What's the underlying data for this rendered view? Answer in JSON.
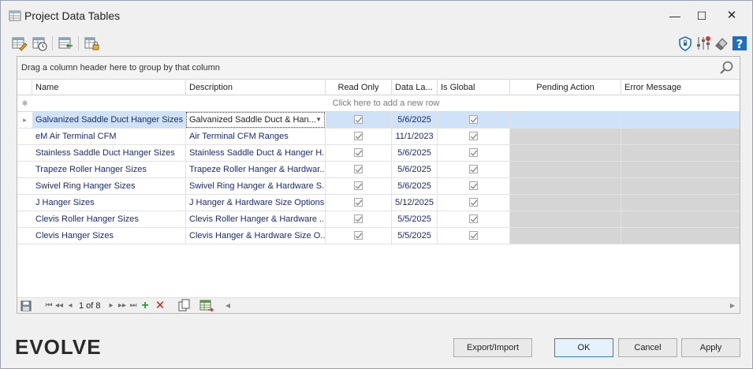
{
  "window": {
    "title": "Project Data Tables",
    "minimize_glyph": "—",
    "maximize_glyph": "☐",
    "close_glyph": "✕"
  },
  "toolbar": {
    "left_icons": [
      "edit-table-icon",
      "table-history-icon",
      "import-table-icon",
      "table-lock-icon"
    ],
    "right_icons": [
      "shield-icon",
      "settings-sliders-icon",
      "eraser-icon",
      "help-icon"
    ]
  },
  "grid": {
    "group_panel_text": "Drag a column header here to group by that column",
    "columns": [
      "Name",
      "Description",
      "Read Only",
      "Data La...",
      "Is Global",
      "Pending Action",
      "Error Message"
    ],
    "new_row_text": "Click here to add a new row",
    "new_row_indicator": "✻",
    "current_row_indicator": "▸",
    "rows": [
      {
        "name": "Galvanized Saddle Duct Hanger Sizes",
        "description": "Galvanized Saddle Duct & Han...",
        "read_only": true,
        "date": "5/6/2025",
        "is_global": true
      },
      {
        "name": "eM Air Terminal CFM",
        "description": "Air Terminal CFM Ranges",
        "read_only": true,
        "date": "11/1/2023",
        "is_global": true
      },
      {
        "name": "Stainless Saddle Duct Hanger Sizes",
        "description": "Stainless Saddle Duct & Hanger H...",
        "read_only": true,
        "date": "5/6/2025",
        "is_global": true
      },
      {
        "name": "Trapeze Roller Hanger Sizes",
        "description": "Trapeze Roller Hanger & Hardwar...",
        "read_only": true,
        "date": "5/6/2025",
        "is_global": true
      },
      {
        "name": "Swivel Ring Hanger Sizes",
        "description": "Swivel Ring Hanger & Hardware S...",
        "read_only": true,
        "date": "5/6/2025",
        "is_global": true
      },
      {
        "name": "J Hanger Sizes",
        "description": "J Hanger & Hardware Size Options",
        "read_only": true,
        "date": "5/12/2025",
        "is_global": true
      },
      {
        "name": "Clevis Roller Hanger Sizes",
        "description": "Clevis Roller Hanger & Hardware ...",
        "read_only": true,
        "date": "5/5/2025",
        "is_global": true
      },
      {
        "name": "Clevis Hanger Sizes",
        "description": "Clevis Hanger & Hardware Size O...",
        "read_only": true,
        "date": "5/5/2025",
        "is_global": true
      }
    ],
    "selected_row": 0
  },
  "navigator": {
    "page_text": "1 of 8",
    "first": "⏮",
    "prev_page": "◂◂",
    "prev": "◂",
    "next": "▸",
    "next_page": "▸▸",
    "last": "⏭",
    "add": "+",
    "delete": "✕"
  },
  "footer": {
    "logo_text": "EVOLVE",
    "export_import_label": "Export/Import",
    "ok_label": "OK",
    "cancel_label": "Cancel",
    "apply_label": "Apply"
  }
}
